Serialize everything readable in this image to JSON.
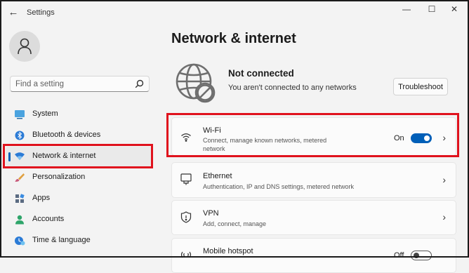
{
  "window": {
    "title": "Settings",
    "minimize": "—",
    "maximize": "☐",
    "close": "✕"
  },
  "sidebar": {
    "search_placeholder": "Find a setting",
    "items": [
      {
        "label": "System",
        "icon": "system-icon"
      },
      {
        "label": "Bluetooth & devices",
        "icon": "bluetooth-icon"
      },
      {
        "label": "Network & internet",
        "icon": "wifi-icon",
        "selected": true
      },
      {
        "label": "Personalization",
        "icon": "brush-icon"
      },
      {
        "label": "Apps",
        "icon": "apps-icon"
      },
      {
        "label": "Accounts",
        "icon": "accounts-icon"
      },
      {
        "label": "Time & language",
        "icon": "clock-icon"
      }
    ]
  },
  "main": {
    "title": "Network & internet",
    "status": {
      "title": "Not connected",
      "subtitle": "You aren't connected to any networks",
      "button": "Troubleshoot"
    },
    "cards": [
      {
        "title": "Wi-Fi",
        "subtitle": "Connect, manage known networks, metered network",
        "toggle_label": "On",
        "toggle": "on",
        "icon": "wifi-icon"
      },
      {
        "title": "Ethernet",
        "subtitle": "Authentication, IP and DNS settings, metered network",
        "icon": "ethernet-icon"
      },
      {
        "title": "VPN",
        "subtitle": "Add, connect, manage",
        "icon": "shield-icon"
      },
      {
        "title": "Mobile hotspot",
        "toggle_label": "Off",
        "toggle": "off",
        "icon": "hotspot-icon"
      }
    ]
  },
  "colors": {
    "accent": "#005fb8",
    "highlight": "#e0121d",
    "background": "#f3f3f3"
  }
}
